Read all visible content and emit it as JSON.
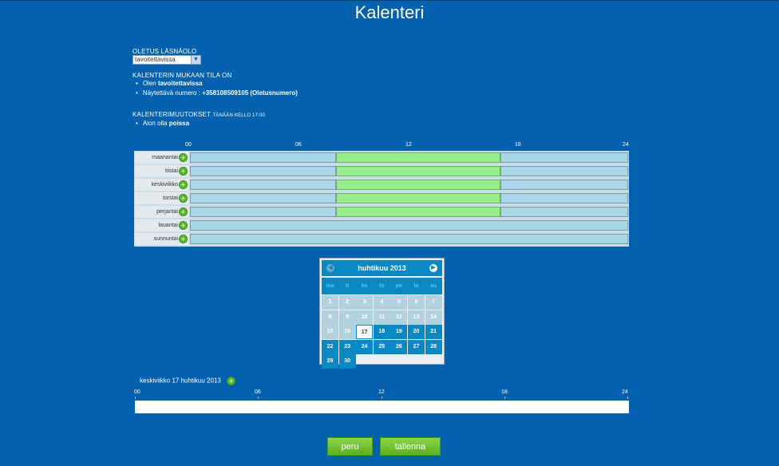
{
  "page": {
    "title": "Kalenteri"
  },
  "default_presence": {
    "label": "OLETUS LÄSNÄOLO",
    "selected": "tavoitettavissa"
  },
  "calendar_state": {
    "label": "KALENTERIN MUKAAN TILA ON",
    "items": [
      {
        "prefix": "Olen ",
        "value": "tavoitettavissa"
      },
      {
        "prefix": "Näytettävä numero : ",
        "value": "+358108509105 (Oletusnumero)"
      }
    ]
  },
  "changes": {
    "label": "KALENTERIMUUTOKSET",
    "when": "TÄNÄÄN KELLO 17:00",
    "items": [
      {
        "prefix": "Aion olla ",
        "value": "poissa"
      }
    ]
  },
  "hour_labels": [
    "00",
    "06",
    "12",
    "18",
    "24"
  ],
  "week": [
    {
      "day": "maanantai",
      "segments": [
        [
          "00:00",
          "08:00",
          "available"
        ],
        [
          "08:00",
          "17:00",
          "busy"
        ],
        [
          "17:00",
          "24:00",
          "available"
        ]
      ]
    },
    {
      "day": "tiistai",
      "segments": [
        [
          "00:00",
          "08:00",
          "available"
        ],
        [
          "08:00",
          "17:00",
          "busy"
        ],
        [
          "17:00",
          "24:00",
          "available"
        ]
      ]
    },
    {
      "day": "keskiviikko",
      "segments": [
        [
          "00:00",
          "08:00",
          "available"
        ],
        [
          "08:00",
          "17:00",
          "busy"
        ],
        [
          "17:00",
          "24:00",
          "available"
        ]
      ]
    },
    {
      "day": "torstai",
      "segments": [
        [
          "00:00",
          "08:00",
          "available"
        ],
        [
          "08:00",
          "17:00",
          "busy"
        ],
        [
          "17:00",
          "24:00",
          "available"
        ]
      ]
    },
    {
      "day": "perjantai",
      "segments": [
        [
          "00:00",
          "08:00",
          "available"
        ],
        [
          "08:00",
          "17:00",
          "busy"
        ],
        [
          "17:00",
          "24:00",
          "available"
        ]
      ]
    },
    {
      "day": "lauantai",
      "segments": [
        [
          "00:00",
          "24:00",
          "available"
        ]
      ]
    },
    {
      "day": "sunnuntai",
      "segments": [
        [
          "00:00",
          "24:00",
          "available"
        ]
      ]
    }
  ],
  "datepicker": {
    "month_title": "huhtikuu 2013",
    "weekdays": [
      "ma",
      "ti",
      "ke",
      "to",
      "pe",
      "la",
      "su"
    ],
    "days": [
      1,
      2,
      3,
      4,
      5,
      6,
      7,
      8,
      9,
      10,
      11,
      12,
      13,
      14,
      15,
      16,
      17,
      18,
      19,
      20,
      21,
      22,
      23,
      24,
      25,
      26,
      27,
      28,
      29,
      30
    ],
    "today": 17,
    "prev_icon": "chevron-left-icon",
    "next_icon": "chevron-right-icon"
  },
  "selected_day": {
    "label": "keskiviikko 17 huhtikuu 2013",
    "hour_labels": [
      "00",
      "06",
      "12",
      "18",
      "24"
    ]
  },
  "buttons": {
    "cancel": "peru",
    "save": "tallenna"
  },
  "colors": {
    "background": "#0461ad",
    "available": "#a8d8e8",
    "busy": "#97ec8c",
    "button_green": "#6cbf2c"
  }
}
